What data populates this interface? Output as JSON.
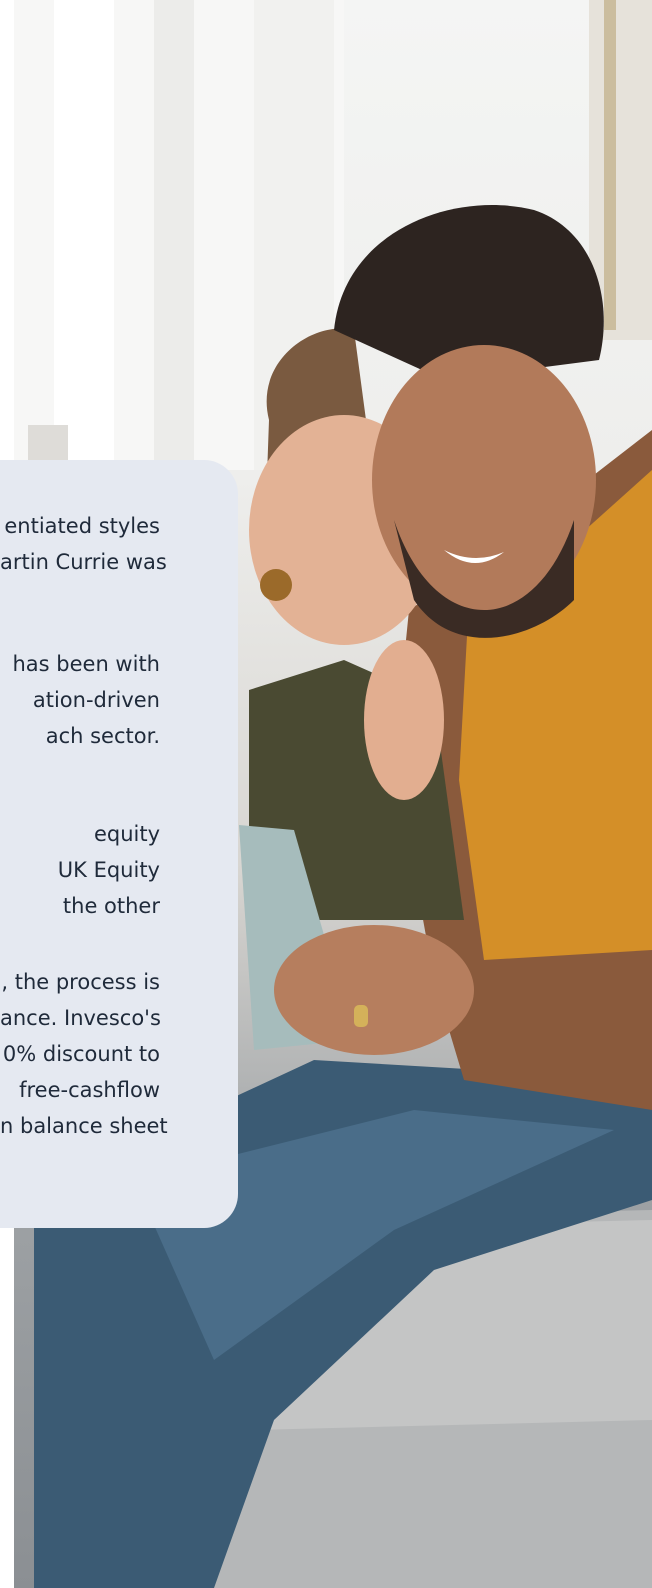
{
  "article_card": {
    "paragraphs": [
      {
        "lines": [
          "entiated styles",
          "artin Currie was"
        ]
      },
      {
        "lines": [
          "has been with",
          "ation-driven",
          "ach sector."
        ]
      },
      {
        "lines": [
          "equity",
          "UK Equity",
          "the other"
        ]
      },
      {
        "lines": [
          ", the process is",
          "ance. Invesco's",
          "0% discount to",
          "free-cashflow",
          "n balance sheet"
        ]
      }
    ]
  },
  "photo": {
    "description_icon": "couple-with-tablet-photo"
  },
  "colors": {
    "card_background": "#e5e9f1",
    "text": "#1f2a3a"
  }
}
